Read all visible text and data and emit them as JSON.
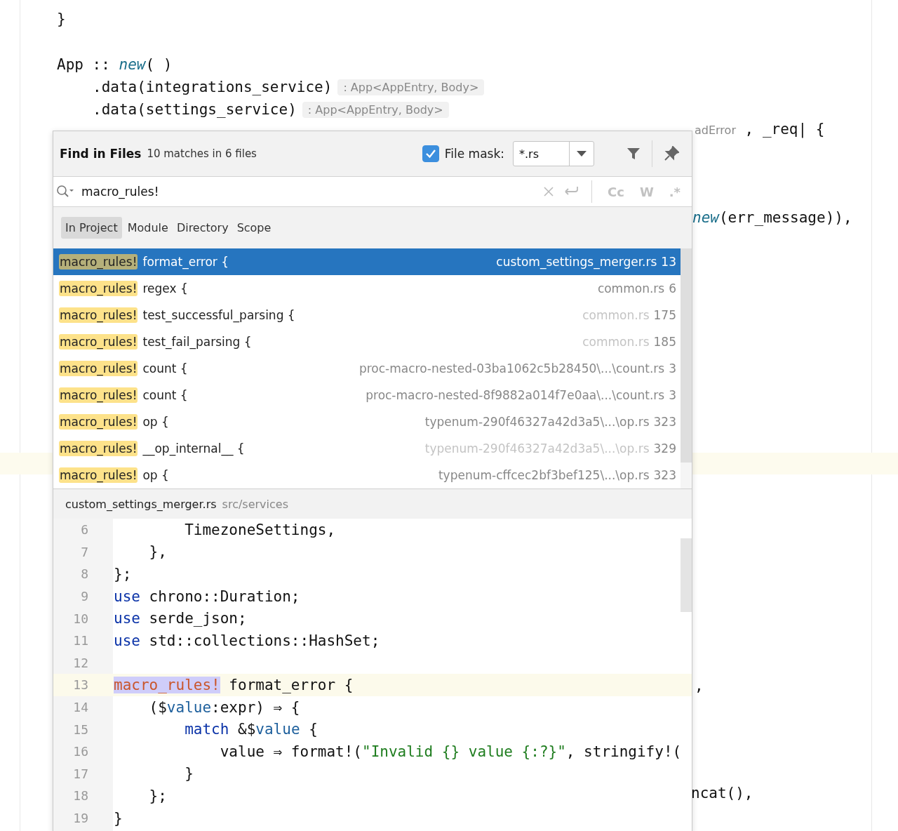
{
  "editor": {
    "lines": [
      {
        "segments": [
          {
            "text": "}"
          }
        ]
      },
      {
        "segments": [
          {
            "text": "App :: "
          },
          {
            "text": "new",
            "kind": "fn"
          },
          {
            "text": "( )"
          }
        ],
        "children": [
          {
            "segments": [
              {
                "text": ".data(integrations_service)"
              }
            ],
            "hint": ": App<AppEntry, Body>"
          },
          {
            "segments": [
              {
                "text": ".data(settings_service)"
              }
            ],
            "hint": ": App<AppEntry, Body>"
          }
        ]
      }
    ],
    "fragments": [
      {
        "segments": [
          {
            "text": "adError",
            "kind": "hint"
          },
          {
            "text": " , _req| {"
          }
        ]
      },
      {
        "segments": [
          {
            "text": "new",
            "kind": "fn"
          },
          {
            "text": "(err_message)),"
          }
        ]
      },
      {
        "segments": [
          {
            "text": ","
          }
        ]
      },
      {
        "segments": [
          {
            "text": "ncat(),"
          }
        ]
      }
    ]
  },
  "find_popup": {
    "title": "Find in Files",
    "summary": "10 matches in 6 files",
    "file_mask": {
      "checked": true,
      "label": "File mask:",
      "value": "*.rs"
    },
    "search": {
      "value": "macro_rules!",
      "options": [
        "Cc",
        "W",
        ".*"
      ]
    },
    "scopes": [
      {
        "label": "In Project",
        "selected": true
      },
      {
        "label": "Module",
        "selected": false
      },
      {
        "label": "Directory",
        "selected": false
      },
      {
        "label": "Scope",
        "selected": false
      }
    ],
    "results": [
      {
        "match": "macro_rules!",
        "text": "format_error {",
        "file": "custom_settings_merger.rs",
        "line": "13",
        "dimmed": false,
        "selected": true
      },
      {
        "match": "macro_rules!",
        "text": "regex {",
        "file": "common.rs",
        "line": "6",
        "dimmed": false,
        "selected": false
      },
      {
        "match": "macro_rules!",
        "text": "test_successful_parsing {",
        "file": "common.rs",
        "line": "175",
        "dimmed": true,
        "selected": false
      },
      {
        "match": "macro_rules!",
        "text": "test_fail_parsing {",
        "file": "common.rs",
        "line": "185",
        "dimmed": true,
        "selected": false
      },
      {
        "match": "macro_rules!",
        "text": "count {",
        "file": "proc-macro-nested-03ba1062c5b28450\\...\\count.rs",
        "line": "3",
        "dimmed": false,
        "selected": false
      },
      {
        "match": "macro_rules!",
        "text": "count {",
        "file": "proc-macro-nested-8f9882a014f7e0aa\\...\\count.rs",
        "line": "3",
        "dimmed": false,
        "selected": false
      },
      {
        "match": "macro_rules!",
        "text": "op {",
        "file": "typenum-290f46327a42d3a5\\...\\op.rs",
        "line": "323",
        "dimmed": false,
        "selected": false
      },
      {
        "match": "macro_rules!",
        "text": "__op_internal__ {",
        "file": "typenum-290f46327a42d3a5\\...\\op.rs",
        "line": "329",
        "dimmed": true,
        "selected": false
      },
      {
        "match": "macro_rules!",
        "text": "op {",
        "file": "typenum-cffcec2bf3bef125\\...\\op.rs",
        "line": "323",
        "dimmed": false,
        "selected": false
      }
    ],
    "preview": {
      "file": "custom_settings_merger.rs",
      "path": "src/services",
      "lines": [
        {
          "number": "6",
          "current": false,
          "segments": [
            {
              "text": "        TimezoneSettings,"
            }
          ]
        },
        {
          "number": "7",
          "current": false,
          "segments": [
            {
              "text": "    },"
            }
          ]
        },
        {
          "number": "8",
          "current": false,
          "segments": [
            {
              "text": "};"
            }
          ]
        },
        {
          "number": "9",
          "current": false,
          "segments": [
            {
              "text": "use",
              "kind": "kw"
            },
            {
              "text": " chrono::Duration;"
            }
          ]
        },
        {
          "number": "10",
          "current": false,
          "segments": [
            {
              "text": "use",
              "kind": "kw"
            },
            {
              "text": " serde_json;"
            }
          ]
        },
        {
          "number": "11",
          "current": false,
          "segments": [
            {
              "text": "use",
              "kind": "kw"
            },
            {
              "text": " std::collections::HashSet;"
            }
          ]
        },
        {
          "number": "12",
          "current": false
        },
        {
          "number": "13",
          "current": true,
          "segments": [
            {
              "text": "macro_rules!",
              "kind": "match"
            },
            {
              "text": " format_error {"
            }
          ]
        },
        {
          "number": "14",
          "current": false,
          "segments": [
            {
              "text": "    ($"
            },
            {
              "text": "value",
              "kind": "var"
            },
            {
              "text": ":expr) ⇒ {"
            }
          ]
        },
        {
          "number": "15",
          "current": false,
          "segments": [
            {
              "text": "        match",
              "kind": "kw"
            },
            {
              "text": " &$"
            },
            {
              "text": "value",
              "kind": "var"
            },
            {
              "text": " {"
            }
          ]
        },
        {
          "number": "16",
          "current": false,
          "segments": [
            {
              "text": "            value ⇒ format!("
            },
            {
              "text": "\"Invalid {} value {:?}\"",
              "kind": "str"
            },
            {
              "text": ", stringify!("
            }
          ]
        },
        {
          "number": "17",
          "current": false,
          "segments": [
            {
              "text": "        }"
            }
          ]
        },
        {
          "number": "18",
          "current": false,
          "segments": [
            {
              "text": "    };"
            }
          ]
        },
        {
          "number": "19",
          "current": false,
          "segments": [
            {
              "text": "}"
            }
          ]
        }
      ]
    }
  }
}
